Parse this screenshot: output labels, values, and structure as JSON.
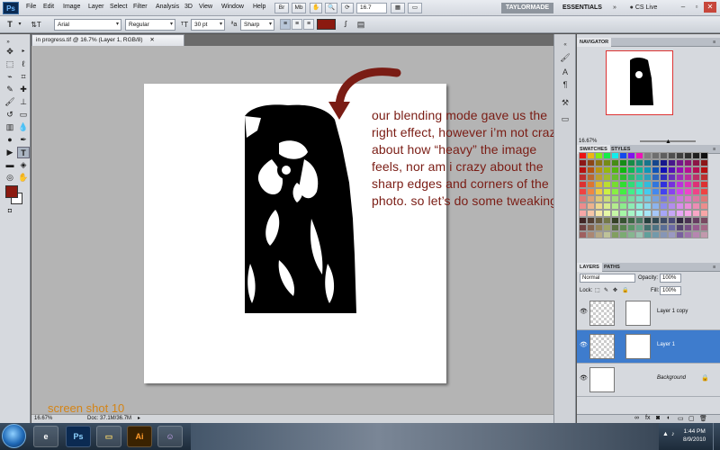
{
  "app": {
    "logo": "Ps",
    "menus": [
      "File",
      "Edit",
      "Image",
      "Layer",
      "Select",
      "Filter",
      "Analysis",
      "3D",
      "View",
      "Window",
      "Help"
    ],
    "zoom_dropdown": "16.7",
    "workspace_user": "TAYLORMADE",
    "workspace_essentials": "ESSENTIALS",
    "cs_live": "CS Live"
  },
  "options_bar": {
    "font_family": "Arial",
    "font_style": "Regular",
    "font_size": "30 pt",
    "antialias": "Sharp",
    "text_color": "#8b1a10"
  },
  "document": {
    "tab_title": "in progress.tif @ 16.7% (Layer 1, RGB/8)",
    "annotation": "our blending mode gave us the right effect, however i’m not crazy about how “heavy” the image feels, nor am i crazy about the sharp edges and corners of the photo. so let’s do some tweaking.",
    "caption": "screen shot 10",
    "status_zoom": "16.67%",
    "status_doc": "Doc: 37.1M/36.7M"
  },
  "panels": {
    "navigator_tab": "NAVIGATOR",
    "navigator_zoom": "16.67%",
    "swatches_tabs": [
      "SWATCHES",
      "STYLES"
    ],
    "layers_tabs": [
      "LAYERS",
      "PATHS"
    ],
    "blend_mode": "Normal",
    "opacity_label": "Opacity:",
    "opacity_value": "100%",
    "lock_label": "Lock:",
    "fill_label": "Fill:",
    "fill_value": "100%",
    "layers": [
      {
        "name": "Layer 1 copy",
        "selected": false
      },
      {
        "name": "Layer 1",
        "selected": true
      },
      {
        "name": "Background",
        "selected": false
      }
    ]
  },
  "colors": {
    "foreground": "#8b1a10",
    "background": "#ffffff",
    "annotation_text": "#7a1c14",
    "caption_text": "#d48416"
  },
  "taskbar": {
    "apps": [
      "Ps",
      "Ai"
    ],
    "time": "1:44 PM",
    "date": "8/9/2010"
  }
}
